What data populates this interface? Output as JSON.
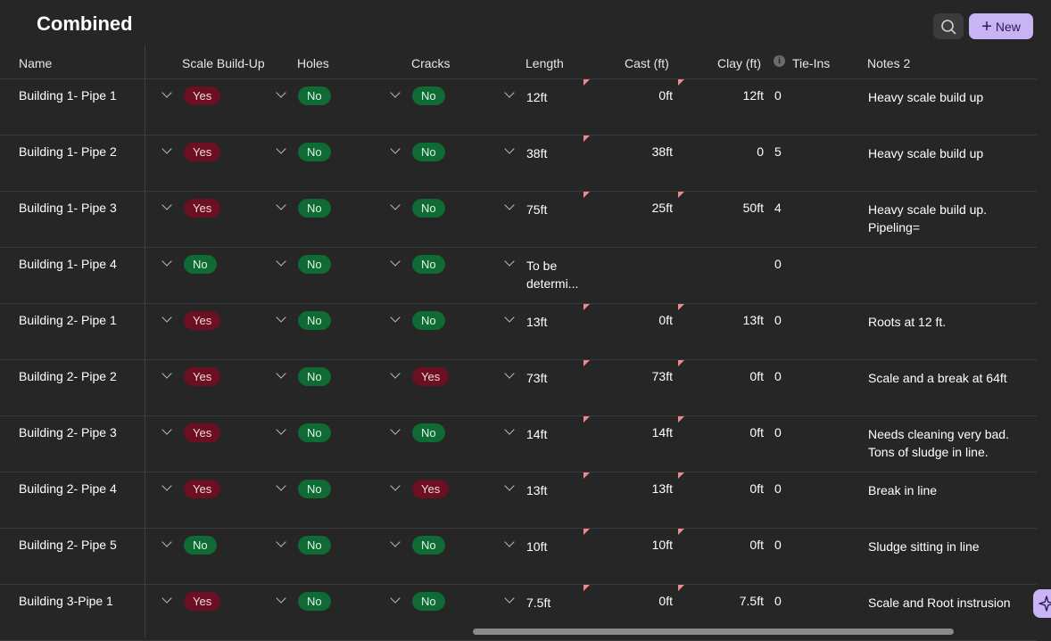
{
  "title": "Combined",
  "actions": {
    "new_label": "New"
  },
  "columns": {
    "name": "Name",
    "scale": "Scale Build-Up",
    "holes": "Holes",
    "cracks": "Cracks",
    "length": "Length",
    "cast": "Cast (ft)",
    "clay": "Clay (ft)",
    "tie": "Tie-Ins",
    "notes": "Notes 2"
  },
  "info_icon_glyph": "i",
  "colors": {
    "yes_pill": "#6b0f22",
    "no_pill": "#0f6a34",
    "accent": "#c8b3f5",
    "flag": "#f08a8a"
  },
  "rows": [
    {
      "name": "Building 1- Pipe 1",
      "scale": "Yes",
      "holes": "No",
      "cracks": "No",
      "length": "12ft",
      "cast": "0ft",
      "clay": "12ft",
      "tie": "0",
      "notes": "Heavy scale build up",
      "flag_length": true,
      "flag_cast": true
    },
    {
      "name": "Building 1- Pipe 2",
      "scale": "Yes",
      "holes": "No",
      "cracks": "No",
      "length": "38ft",
      "cast": "38ft",
      "clay": "0",
      "tie": "5",
      "notes": "Heavy scale build up",
      "flag_length": true,
      "flag_cast": false
    },
    {
      "name": "Building 1- Pipe 3",
      "scale": "Yes",
      "holes": "No",
      "cracks": "No",
      "length": "75ft",
      "cast": "25ft",
      "clay": "50ft",
      "tie": "4",
      "notes": "Heavy scale build up. Pipeling=",
      "flag_length": true,
      "flag_cast": true
    },
    {
      "name": "Building 1- Pipe 4",
      "scale": "No",
      "holes": "No",
      "cracks": "No",
      "length": "To be determi...",
      "cast": "",
      "clay": "",
      "tie": "0",
      "notes": "",
      "flag_length": false,
      "flag_cast": false
    },
    {
      "name": "Building 2- Pipe 1",
      "scale": "Yes",
      "holes": "No",
      "cracks": "No",
      "length": "13ft",
      "cast": "0ft",
      "clay": "13ft",
      "tie": "0",
      "notes": "Roots at 12 ft.",
      "flag_length": true,
      "flag_cast": true
    },
    {
      "name": "Building 2- Pipe 2",
      "scale": "Yes",
      "holes": "No",
      "cracks": "Yes",
      "length": "73ft",
      "cast": "73ft",
      "clay": "0ft",
      "tie": "0",
      "notes": "Scale and a break at 64ft",
      "flag_length": true,
      "flag_cast": true
    },
    {
      "name": "Building 2- Pipe 3",
      "scale": "Yes",
      "holes": "No",
      "cracks": "No",
      "length": "14ft",
      "cast": "14ft",
      "clay": "0ft",
      "tie": "0",
      "notes": "Needs cleaning very bad. Tons of sludge in line.",
      "flag_length": true,
      "flag_cast": true
    },
    {
      "name": "Building 2- Pipe 4",
      "scale": "Yes",
      "holes": "No",
      "cracks": "Yes",
      "length": "13ft",
      "cast": "13ft",
      "clay": "0ft",
      "tie": "0",
      "notes": "Break in line",
      "flag_length": true,
      "flag_cast": true
    },
    {
      "name": "Building 2- Pipe 5",
      "scale": "No",
      "holes": "No",
      "cracks": "No",
      "length": "10ft",
      "cast": "10ft",
      "clay": "0ft",
      "tie": "0",
      "notes": "Sludge sitting in line",
      "flag_length": true,
      "flag_cast": true
    },
    {
      "name": "Building 3-Pipe 1",
      "scale": "Yes",
      "holes": "No",
      "cracks": "No",
      "length": "7.5ft",
      "cast": "0ft",
      "clay": "7.5ft",
      "tie": "0",
      "notes": "Scale and Root instrusion",
      "flag_length": true,
      "flag_cast": true
    }
  ]
}
